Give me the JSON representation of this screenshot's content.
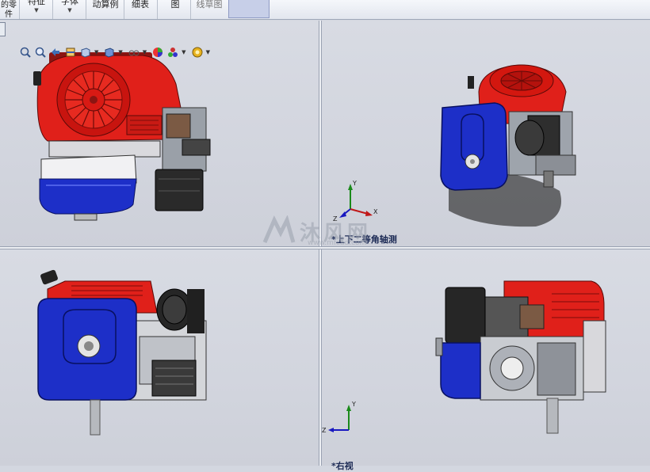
{
  "ribbon": {
    "items": [
      {
        "label": "的零\n件",
        "has_dropdown": false
      },
      {
        "label": "特征",
        "has_dropdown": true
      },
      {
        "label": "字体",
        "has_dropdown": true
      },
      {
        "label": "动算例",
        "has_dropdown": false
      },
      {
        "label": "细表",
        "has_dropdown": false
      },
      {
        "label": "图",
        "has_dropdown": false
      },
      {
        "label": "线草图",
        "has_dropdown": false
      }
    ]
  },
  "hud_toolbar": {
    "icons": [
      "zoom-to-fit-icon",
      "zoom-to-area-icon",
      "previous-view-icon",
      "section-view-icon",
      "view-orientation-icon",
      "display-style-icon",
      "hide-show-items-icon",
      "edit-appearance-icon",
      "apply-scene-icon",
      "view-settings-icon"
    ]
  },
  "viewports": {
    "top_right": {
      "label": "*上下二等角轴测"
    },
    "bottom_right": {
      "label": "*右视"
    }
  },
  "triad": {
    "x": "X",
    "y": "Y",
    "z": "Z"
  },
  "watermark": {
    "text": "沐风网",
    "url": "www.mfcad.com"
  },
  "colors": {
    "engine_red": "#e0201a",
    "tank_blue": "#1d2fc8",
    "viewport_bg": "#d3d6df"
  }
}
